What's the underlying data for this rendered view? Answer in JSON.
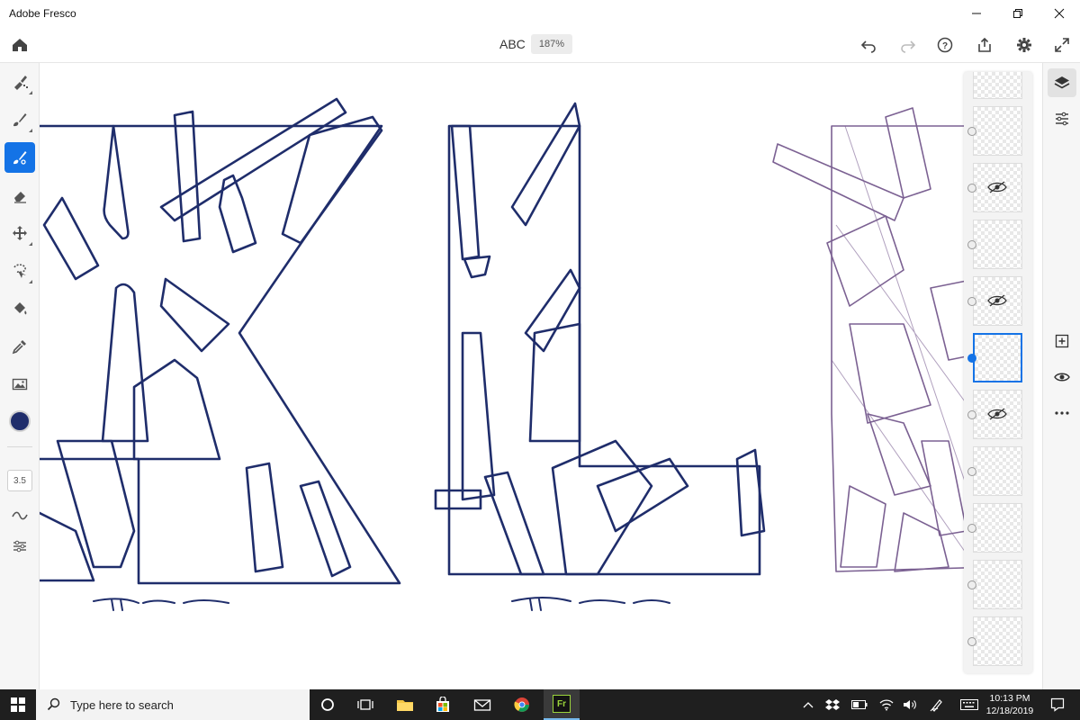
{
  "window": {
    "title": "Adobe Fresco"
  },
  "header": {
    "doc_title": "ABC",
    "zoom": "187%"
  },
  "tool_size": "3.5",
  "brush_color": "#1f2d6b",
  "accent": "#1473e6",
  "left_tools": [
    "pixel-brush-icon",
    "live-brush-icon",
    "vector-brush-icon",
    "eraser-icon",
    "move-icon",
    "lasso-icon",
    "fill-icon",
    "eyedropper-icon",
    "image-icon"
  ],
  "layers": {
    "selected_index": 5,
    "hidden_indexes": [
      2,
      4,
      6
    ]
  },
  "taskbar": {
    "search_placeholder": "Type here to search",
    "time": "10:13 PM",
    "date": "12/18/2019",
    "fresco_label": "Fr"
  }
}
